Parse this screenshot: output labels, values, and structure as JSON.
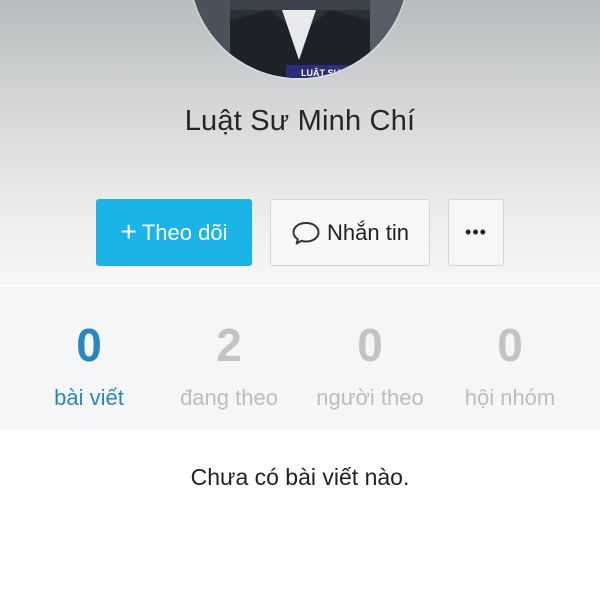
{
  "profile": {
    "name": "Luật Sư Minh Chí",
    "avatar_badge": "LUẬT SƯ"
  },
  "actions": {
    "follow_label": "Theo dõi",
    "message_label": "Nhắn tin",
    "more_label": "•••"
  },
  "stats": [
    {
      "value": "0",
      "label": "bài viết",
      "active": true
    },
    {
      "value": "2",
      "label": "đang theo",
      "active": false
    },
    {
      "value": "0",
      "label": "người theo",
      "active": false
    },
    {
      "value": "0",
      "label": "hội nhóm",
      "active": false
    }
  ],
  "feed": {
    "empty_message": "Chưa có bài viết nào."
  },
  "colors": {
    "accent": "#1cb4e6",
    "active_stat": "#2a86bf",
    "inactive_stat": "#c3c3c3"
  }
}
